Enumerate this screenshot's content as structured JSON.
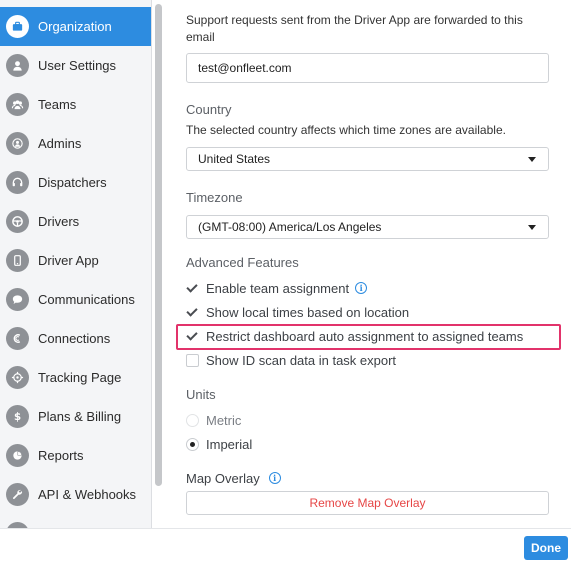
{
  "sidebar": {
    "items": [
      {
        "label": "Organization",
        "icon": "briefcase-icon",
        "active": true
      },
      {
        "label": "User Settings",
        "icon": "user-icon"
      },
      {
        "label": "Teams",
        "icon": "teams-icon"
      },
      {
        "label": "Admins",
        "icon": "admin-icon"
      },
      {
        "label": "Dispatchers",
        "icon": "headset-icon"
      },
      {
        "label": "Drivers",
        "icon": "steering-wheel-icon"
      },
      {
        "label": "Driver App",
        "icon": "phone-icon"
      },
      {
        "label": "Communications",
        "icon": "chat-bubble-icon"
      },
      {
        "label": "Connections",
        "icon": "connections-icon"
      },
      {
        "label": "Tracking Page",
        "icon": "crosshair-icon"
      },
      {
        "label": "Plans & Billing",
        "icon": "dollar-icon"
      },
      {
        "label": "Reports",
        "icon": "pie-chart-icon"
      },
      {
        "label": "API & Webhooks",
        "icon": "wrench-icon"
      }
    ]
  },
  "support": {
    "description": "Support requests sent from the Driver App are forwarded to this email",
    "email": "test@onfleet.com"
  },
  "country": {
    "label": "Country",
    "description": "The selected country affects which time zones are available.",
    "value": "United States"
  },
  "timezone": {
    "label": "Timezone",
    "value": "(GMT-08:00) America/Los Angeles"
  },
  "advanced": {
    "label": "Advanced Features",
    "options": [
      {
        "label": "Enable team assignment",
        "checked": true,
        "info": true
      },
      {
        "label": "Show local times based on location",
        "checked": true
      },
      {
        "label": "Restrict dashboard auto assignment to assigned teams",
        "checked": true,
        "highlighted": true
      },
      {
        "label": "Show ID scan data in task export",
        "checked": false
      }
    ]
  },
  "units": {
    "label": "Units",
    "options": [
      {
        "label": "Metric",
        "selected": false
      },
      {
        "label": "Imperial",
        "selected": true
      }
    ]
  },
  "map_overlay": {
    "label": "Map Overlay",
    "remove_button": "Remove Map Overlay"
  },
  "footer": {
    "done_label": "Done"
  },
  "colors": {
    "accent": "#2d8ce0",
    "highlight": "#e2336b",
    "danger": "#e64646"
  }
}
